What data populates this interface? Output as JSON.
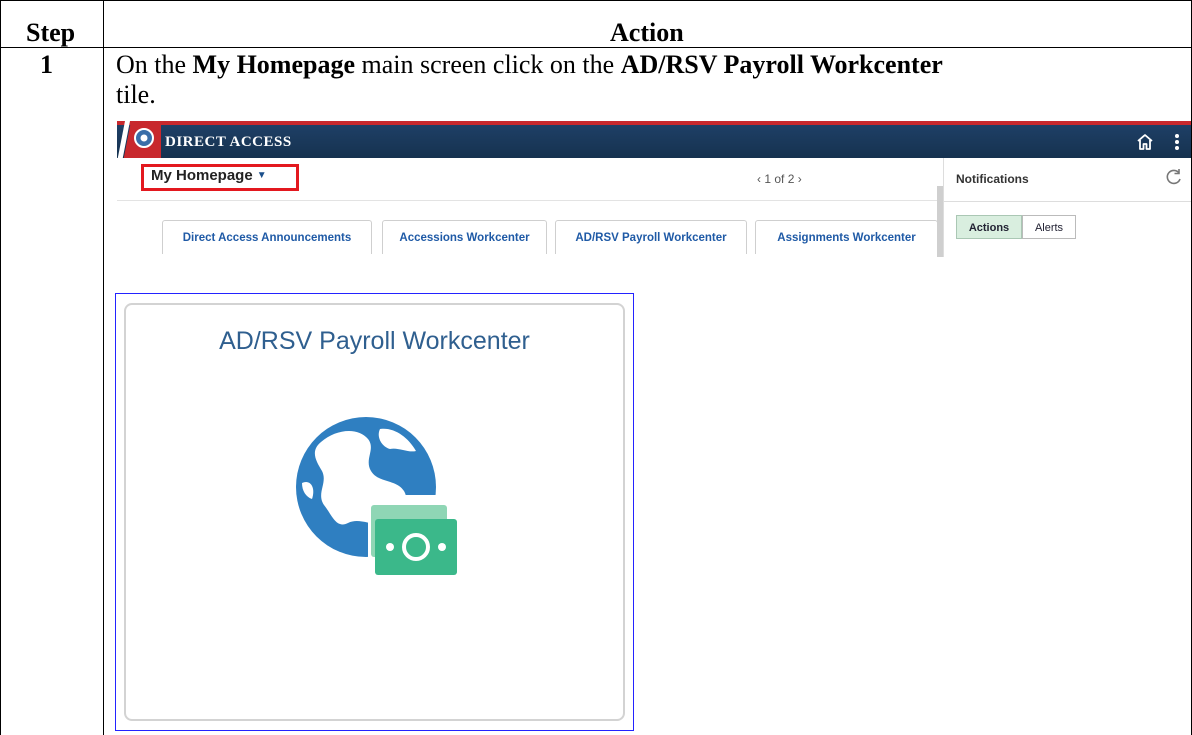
{
  "table": {
    "header_step": "Step",
    "header_action": "Action",
    "step_number": "1",
    "instruction": {
      "pre": "On the ",
      "bold1": "My Homepage",
      "mid": " main screen click on the ",
      "bold2": "AD/RSV Payroll Workcenter",
      "post": " tile."
    }
  },
  "app": {
    "brand": "DIRECT ACCESS",
    "homepage_label": "My Homepage",
    "pager": "1 of 2",
    "tabs": [
      "Direct Access Announcements",
      "Accessions Workcenter",
      "AD/RSV Payroll Workcenter",
      "Assignments Workcenter"
    ],
    "notifications": {
      "title": "Notifications",
      "actions_label": "Actions",
      "alerts_label": "Alerts"
    }
  },
  "tile": {
    "title": "AD/RSV Payroll Workcenter",
    "icon": "globe-money-icon"
  },
  "colors": {
    "banner": "#16324f",
    "highlight_border": "#e3181f",
    "tile_title": "#2f5f8f",
    "globe": "#2f7fc1",
    "money": "#3bb88a"
  }
}
